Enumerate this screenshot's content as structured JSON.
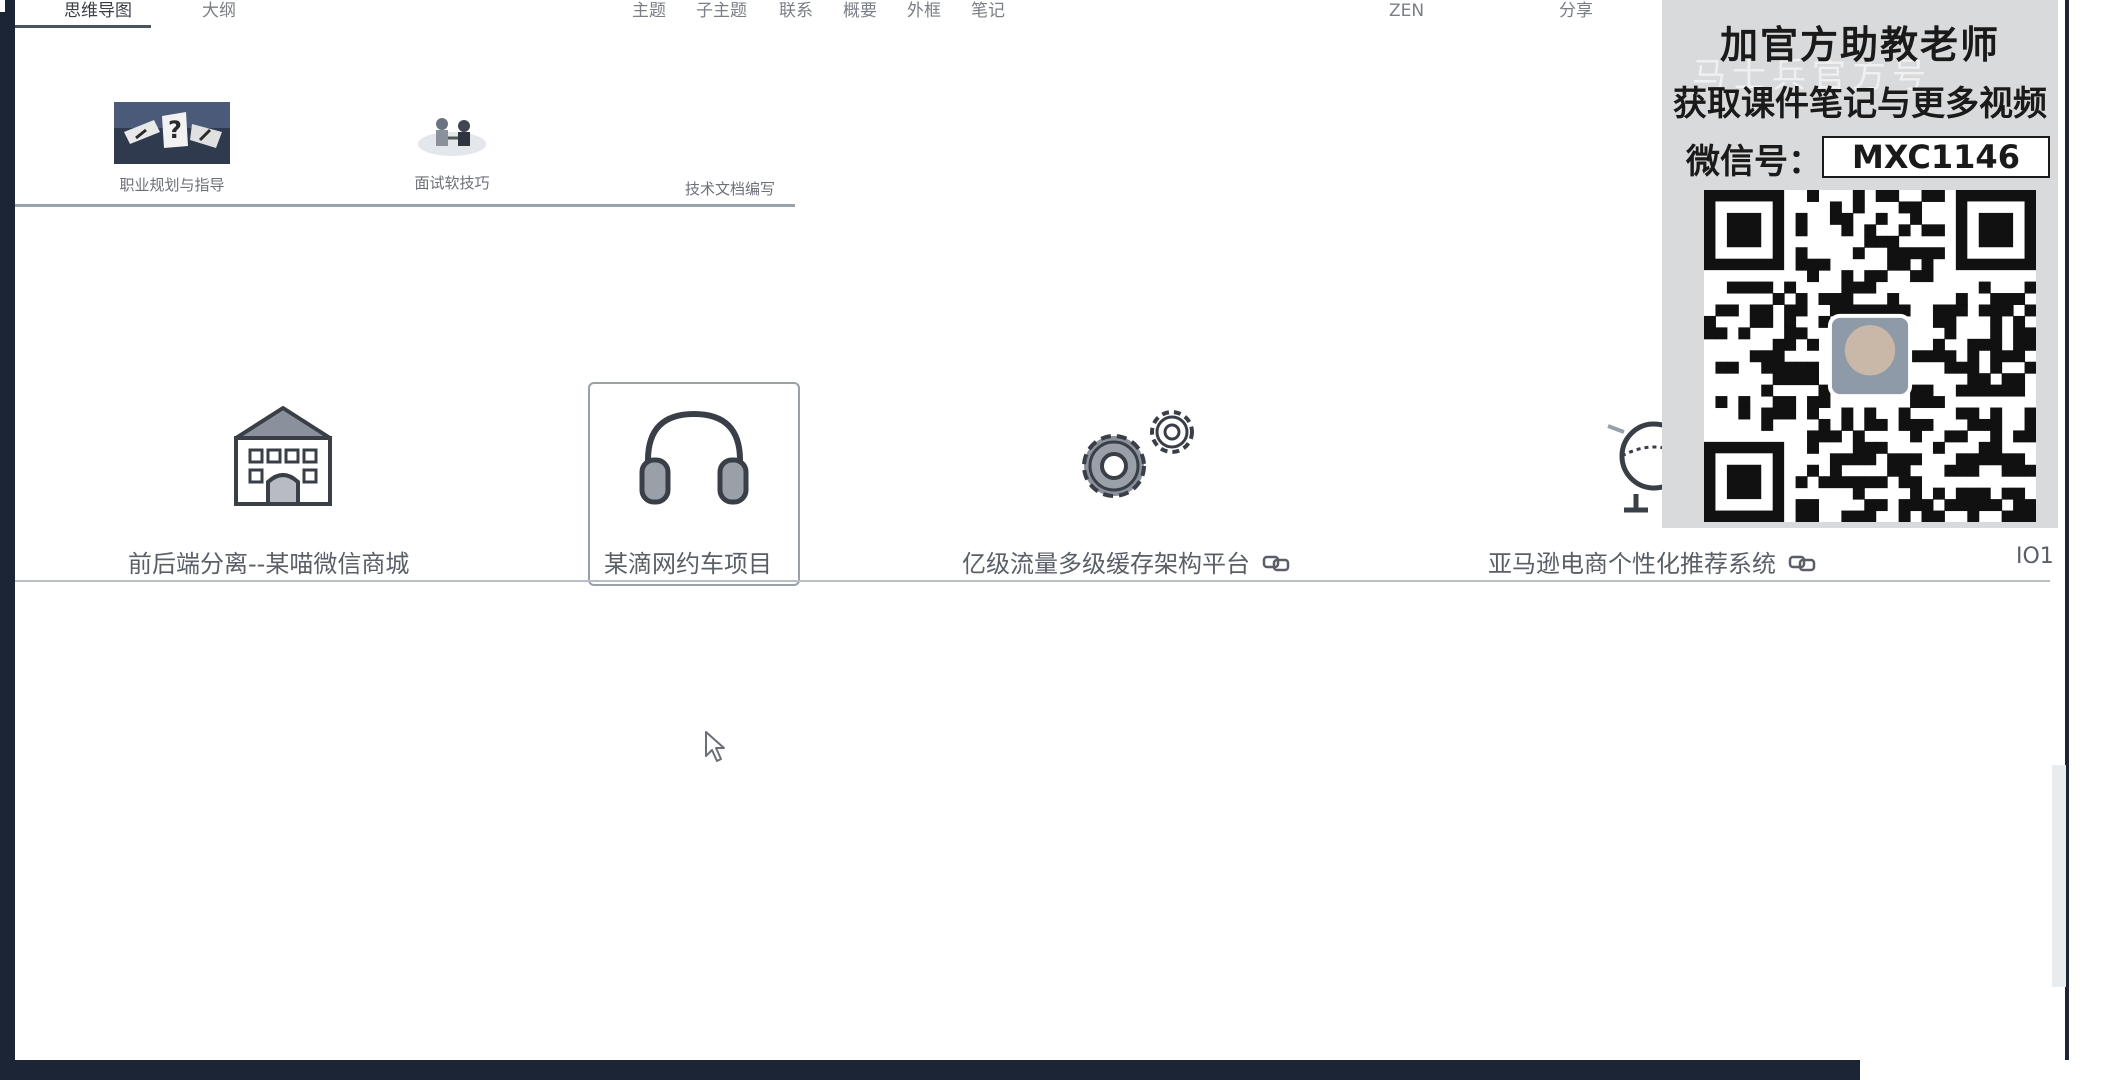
{
  "toolbar": {
    "tabs": [
      {
        "label": "思维导图",
        "active": true
      },
      {
        "label": "大纲",
        "active": false
      }
    ],
    "actions": [
      "主题",
      "子主题",
      "联系",
      "概要",
      "外框",
      "笔记"
    ],
    "zen": "ZEN",
    "share": "分享"
  },
  "upper_nodes": [
    {
      "label": "职业规划与指导",
      "icon": "direction-signs-image"
    },
    {
      "label": "面试软技巧",
      "icon": "handshake-illustration"
    },
    {
      "label": "技术文档编写",
      "icon": ""
    }
  ],
  "main_nodes": [
    {
      "label": "前后端分离--某喵微信商城",
      "icon": "building-icon",
      "linked": false,
      "selected": false
    },
    {
      "label": "某滴网约车项目",
      "icon": "headphones-icon",
      "linked": false,
      "selected": true
    },
    {
      "label": "亿级流量多级缓存架构平台",
      "icon": "gears-icon",
      "linked": true,
      "selected": false
    },
    {
      "label": "亚马逊电商个性化推荐系统",
      "icon": "globe-icon",
      "linked": true,
      "selected": false
    },
    {
      "label": "IO1",
      "icon": "",
      "linked": false,
      "selected": false
    }
  ],
  "promo": {
    "title": "加官方助教老师",
    "ghost_text": "马士兵官方号",
    "subtitle": "获取课件笔记与更多视频",
    "wechat_label": "微信号：",
    "wechat_id": "MXC1146"
  },
  "colors": {
    "frame": "#1c2536",
    "canvas": "#ffffff",
    "icon_gray": "#5d6470",
    "promo_bg": "#d9dadb"
  }
}
